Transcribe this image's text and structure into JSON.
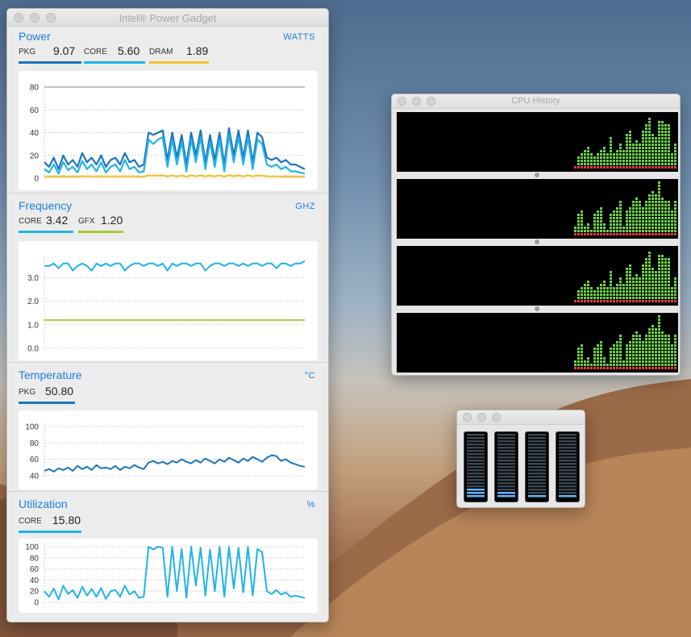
{
  "gadget": {
    "title": "Intel® Power Gadget",
    "power": {
      "title": "Power",
      "unit": "WATTS",
      "metrics": [
        {
          "label": "PKG",
          "value": "9.07",
          "color": "#1a75bc"
        },
        {
          "label": "CORE",
          "value": "5.60",
          "color": "#21b3e8"
        },
        {
          "label": "DRAM",
          "value": "1.89",
          "color": "#f2c12e"
        }
      ],
      "y_ticks": [
        "80",
        "60",
        "40",
        "20",
        "0"
      ]
    },
    "frequency": {
      "title": "Frequency",
      "unit": "GHZ",
      "metrics": [
        {
          "label": "CORE",
          "value": "3.42",
          "color": "#21b3e8"
        },
        {
          "label": "GFX",
          "value": "1.20",
          "color": "#a6cd3c"
        }
      ],
      "y_ticks": [
        "3.0",
        "2.0",
        "1.0",
        "0.0"
      ]
    },
    "temperature": {
      "title": "Temperature",
      "unit": "°C",
      "metrics": [
        {
          "label": "PKG",
          "value": "50.80",
          "color": "#1a75bc"
        }
      ],
      "y_ticks": [
        "100",
        "80",
        "60",
        "40"
      ]
    },
    "utilization": {
      "title": "Utilization",
      "unit": "%",
      "metrics": [
        {
          "label": "CORE",
          "value": "15.80",
          "color": "#21b3e8"
        }
      ],
      "y_ticks": [
        "100",
        "80",
        "60",
        "40",
        "20",
        "0"
      ]
    }
  },
  "cpu_history": {
    "title": "CPU History",
    "cores": 4
  },
  "cpu_usage": {
    "meters": [
      {
        "level": 0.14
      },
      {
        "level": 0.1
      },
      {
        "level": 0.06
      },
      {
        "level": 0.06
      }
    ]
  },
  "chart_data": [
    {
      "type": "line",
      "ylim": [
        0,
        80
      ],
      "series": [
        {
          "name": "PKG",
          "color": "#1a75bc",
          "values": [
            14,
            10,
            18,
            8,
            20,
            12,
            16,
            10,
            22,
            14,
            18,
            12,
            20,
            10,
            16,
            18,
            12,
            22,
            14,
            16,
            10,
            12,
            40,
            38,
            40,
            42,
            16,
            40,
            18,
            38,
            12,
            40,
            20,
            42,
            14,
            38,
            16,
            40,
            12,
            44,
            20,
            42,
            18,
            42,
            14,
            40,
            36,
            18,
            16,
            18,
            14,
            16,
            12,
            12,
            10,
            8
          ]
        },
        {
          "name": "CORE",
          "color": "#21b3e8",
          "values": [
            8,
            5,
            12,
            4,
            14,
            7,
            10,
            5,
            15,
            8,
            12,
            6,
            14,
            5,
            10,
            12,
            6,
            16,
            8,
            10,
            5,
            6,
            34,
            30,
            34,
            36,
            10,
            34,
            12,
            32,
            6,
            34,
            14,
            36,
            8,
            32,
            10,
            34,
            6,
            38,
            14,
            36,
            12,
            36,
            8,
            34,
            30,
            12,
            10,
            12,
            8,
            10,
            6,
            6,
            5,
            4
          ]
        },
        {
          "name": "DRAM",
          "color": "#f2c12e",
          "values": [
            1.5,
            1.5,
            1.6,
            1.5,
            1.7,
            1.5,
            1.6,
            1.5,
            1.7,
            1.6,
            1.6,
            1.5,
            1.7,
            1.5,
            1.6,
            1.6,
            1.5,
            1.7,
            1.6,
            1.6,
            1.5,
            1.5,
            2.4,
            2.3,
            2.4,
            2.5,
            1.6,
            2.4,
            1.6,
            2.3,
            1.5,
            2.4,
            1.7,
            2.5,
            1.6,
            2.3,
            1.6,
            2.4,
            1.5,
            2.6,
            1.7,
            2.5,
            1.6,
            2.5,
            1.6,
            2.4,
            2.2,
            1.6,
            1.6,
            1.6,
            1.5,
            1.6,
            1.5,
            1.5,
            1.5,
            1.5
          ]
        }
      ]
    },
    {
      "type": "line",
      "ylim": [
        0,
        3.8
      ],
      "series": [
        {
          "name": "CORE",
          "color": "#21b3e8",
          "values": [
            3.5,
            3.5,
            3.6,
            3.4,
            3.6,
            3.6,
            3.3,
            3.5,
            3.6,
            3.5,
            3.3,
            3.6,
            3.5,
            3.6,
            3.5,
            3.6,
            3.6,
            3.3,
            3.5,
            3.6,
            3.6,
            3.5,
            3.6,
            3.6,
            3.5,
            3.6,
            3.3,
            3.6,
            3.5,
            3.6,
            3.6,
            3.5,
            3.6,
            3.6,
            3.3,
            3.5,
            3.6,
            3.6,
            3.5,
            3.6,
            3.6,
            3.5,
            3.6,
            3.5,
            3.6,
            3.6,
            3.5,
            3.6,
            3.6,
            3.4,
            3.6,
            3.6,
            3.5,
            3.6,
            3.6,
            3.7
          ]
        },
        {
          "name": "GFX",
          "color": "#a6cd3c",
          "values": [
            1.2,
            1.2,
            1.2,
            1.2,
            1.2,
            1.2,
            1.2,
            1.2,
            1.2,
            1.2,
            1.2,
            1.2,
            1.2,
            1.2,
            1.2,
            1.2,
            1.2,
            1.2,
            1.2,
            1.2,
            1.2,
            1.2,
            1.2,
            1.2,
            1.2,
            1.2,
            1.2,
            1.2,
            1.2,
            1.2,
            1.2,
            1.2,
            1.2,
            1.2,
            1.2,
            1.2,
            1.2,
            1.2,
            1.2,
            1.2,
            1.2,
            1.2,
            1.2,
            1.2,
            1.2,
            1.2,
            1.2,
            1.2,
            1.2,
            1.2,
            1.2,
            1.2,
            1.2,
            1.2,
            1.2,
            1.2
          ]
        }
      ]
    },
    {
      "type": "line",
      "ylim": [
        38,
        100
      ],
      "series": [
        {
          "name": "PKG",
          "color": "#1a75bc",
          "values": [
            46,
            48,
            45,
            49,
            47,
            50,
            46,
            52,
            48,
            51,
            47,
            53,
            49,
            50,
            48,
            52,
            47,
            51,
            49,
            53,
            50,
            48,
            56,
            58,
            55,
            57,
            54,
            58,
            56,
            60,
            57,
            55,
            59,
            56,
            61,
            58,
            55,
            60,
            57,
            62,
            59,
            56,
            61,
            58,
            63,
            60,
            57,
            62,
            65,
            64,
            58,
            60,
            56,
            54,
            52,
            51
          ]
        }
      ]
    },
    {
      "type": "line",
      "ylim": [
        0,
        100
      ],
      "series": [
        {
          "name": "CORE",
          "color": "#21b3e8",
          "values": [
            20,
            10,
            25,
            5,
            30,
            15,
            22,
            8,
            28,
            12,
            24,
            10,
            26,
            6,
            20,
            22,
            10,
            30,
            14,
            20,
            8,
            10,
            100,
            95,
            100,
            98,
            10,
            100,
            20,
            96,
            8,
            100,
            30,
            98,
            12,
            95,
            20,
            100,
            10,
            100,
            25,
            98,
            18,
            100,
            12,
            96,
            90,
            20,
            15,
            22,
            14,
            18,
            10,
            12,
            10,
            8
          ]
        }
      ]
    }
  ]
}
